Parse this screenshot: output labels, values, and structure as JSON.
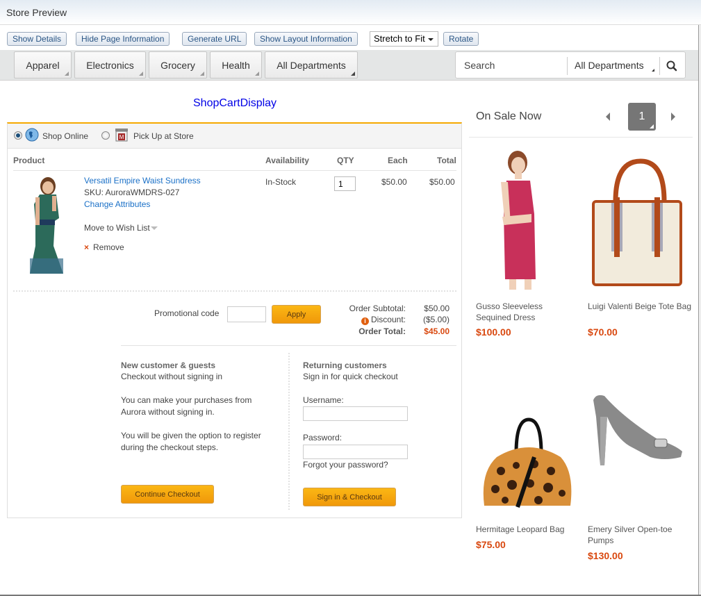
{
  "window": {
    "title": "Store Preview"
  },
  "toolbar": {
    "show_details": "Show Details",
    "hide_page_info": "Hide Page Information",
    "generate_url": "Generate URL",
    "show_layout_info": "Show Layout Information",
    "zoom_select": "Stretch to Fit",
    "rotate": "Rotate"
  },
  "departments": [
    {
      "label": "Apparel"
    },
    {
      "label": "Electronics"
    },
    {
      "label": "Grocery"
    },
    {
      "label": "Health"
    },
    {
      "label": "All Departments"
    }
  ],
  "search": {
    "placeholder": "Search",
    "department": "All Departments"
  },
  "cart": {
    "title": "ShopCartDisplay",
    "shipping_options": [
      {
        "label": "Shop Online",
        "selected": true,
        "icon": "globe-icon"
      },
      {
        "label": "Pick Up at Store",
        "selected": false,
        "icon": "store-icon"
      }
    ],
    "columns": [
      "Product",
      "Availability",
      "QTY",
      "Each",
      "Total"
    ],
    "items": [
      {
        "name": "Versatil Empire Waist Sundress",
        "sku": "SKU: AuroraWMDRS-027",
        "change_attributes": "Change Attributes",
        "move_to_wishlist": "Move to Wish List",
        "remove": "Remove",
        "availability": "In-Stock",
        "qty": "1",
        "each": "$50.00",
        "total": "$50.00"
      }
    ],
    "promo": {
      "label": "Promotional code",
      "value": "",
      "apply": "Apply"
    },
    "summary": {
      "subtotal_label": "Order Subtotal:",
      "subtotal": "$50.00",
      "discount_label": "Discount:",
      "discount": "($5.00)",
      "total_label": "Order Total:",
      "total": "$45.00"
    },
    "guest": {
      "heading": "New customer & guests",
      "subheading": "Checkout without signing in",
      "text1": "You can make your purchases from Aurora without signing in.",
      "text2": "You will be given the option to register during the checkout steps.",
      "button": "Continue Checkout"
    },
    "returning": {
      "heading": "Returning customers",
      "subheading": "Sign in for quick checkout",
      "username_label": "Username:",
      "username_value": "",
      "password_label": "Password:",
      "password_value": "",
      "forgot": "Forgot your password?",
      "button": "Sign in & Checkout"
    }
  },
  "on_sale": {
    "title": "On Sale Now",
    "current_page": "1",
    "products": [
      {
        "name": "Gusso Sleeveless Sequined Dress",
        "price": "$100.00"
      },
      {
        "name": "Luigi Valenti Beige Tote Bag",
        "price": "$70.00"
      },
      {
        "name": "Hermitage Leopard Bag",
        "price": "$75.00"
      },
      {
        "name": "Emery Silver Open-toe Pumps",
        "price": "$130.00"
      }
    ]
  }
}
